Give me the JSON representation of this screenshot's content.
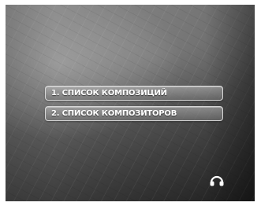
{
  "menu": {
    "items": [
      {
        "label": "1. СПИСОК КОМПОЗИЦИЙ"
      },
      {
        "label": "2. СПИСОК КОМПОЗИТОРОВ"
      }
    ]
  },
  "indicators": {
    "icon": "headphones-icon"
  },
  "colors": {
    "menu_text": "#ffffff",
    "menu_border": "#d8d8d8",
    "background_dark": "#1f1f1f",
    "background_light": "#8c8c8c"
  }
}
